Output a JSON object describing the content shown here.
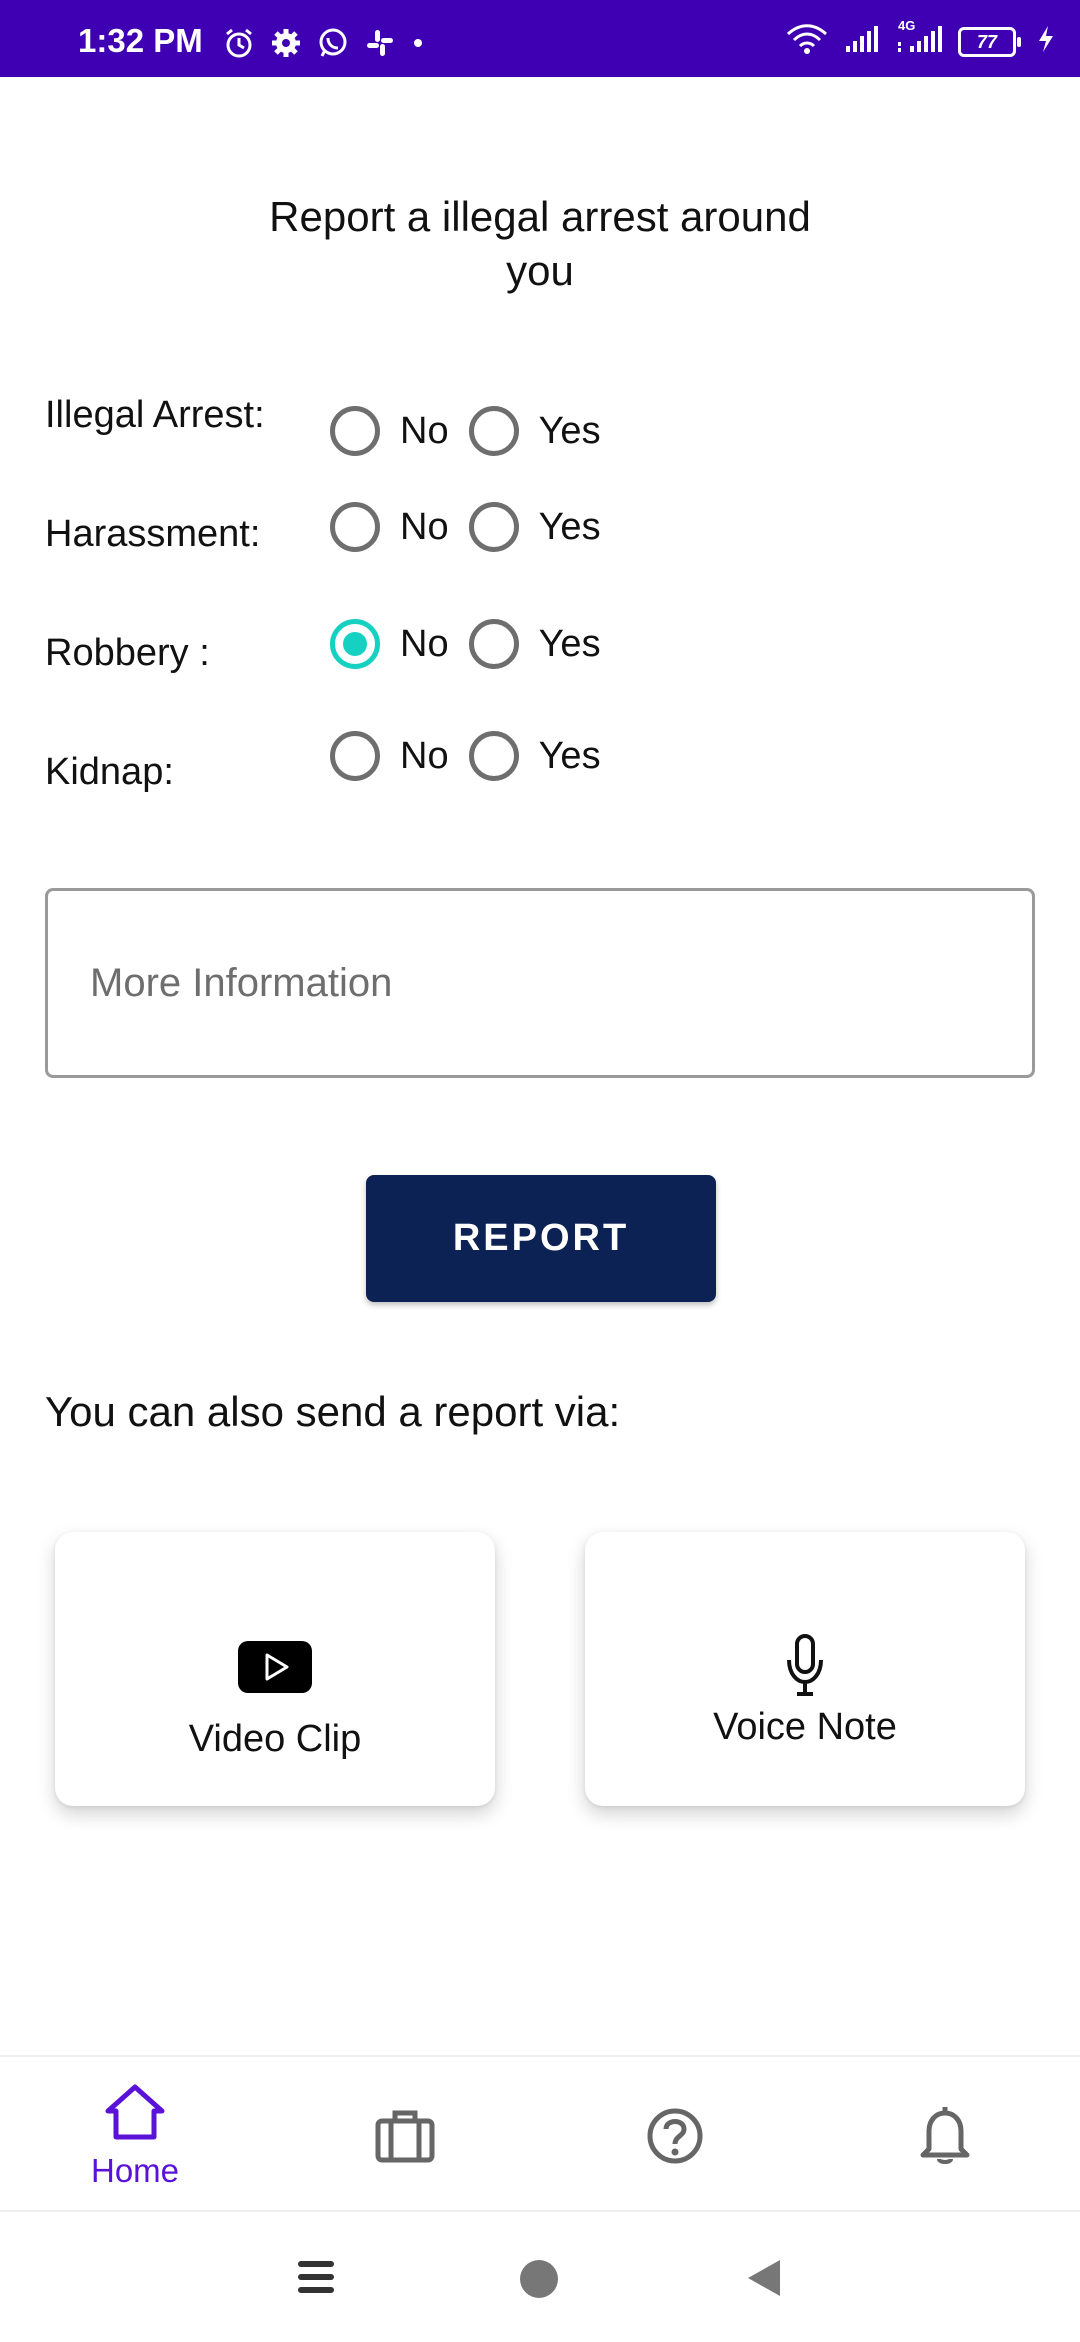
{
  "status_bar": {
    "time": "1:32 PM",
    "battery": "77",
    "network": "4G",
    "icons": [
      "alarm-icon",
      "settings-icon",
      "whatsapp-icon",
      "slack-icon",
      "dot-icon",
      "wifi-icon",
      "signal-icon",
      "signal-4g-icon",
      "battery-icon",
      "charging-icon"
    ]
  },
  "title": {
    "line1": "Report a illegal arrest around",
    "line2": "you"
  },
  "questions": [
    {
      "label": "Illegal Arrest:",
      "no": "No",
      "yes": "Yes",
      "selected": null
    },
    {
      "label": "Harassment:",
      "no": "No",
      "yes": "Yes",
      "selected": null
    },
    {
      "label": "Robbery :",
      "no": "No",
      "yes": "Yes",
      "selected": "No"
    },
    {
      "label": "Kidnap:",
      "no": "No",
      "yes": "Yes",
      "selected": null
    }
  ],
  "more_info": {
    "placeholder": "More Information",
    "value": ""
  },
  "report_button": "REPORT",
  "alternative": {
    "heading": "You can also send a report via:",
    "video": {
      "label": "Video Clip",
      "icon": "play-icon"
    },
    "voice": {
      "label": "Voice Note",
      "icon": "microphone-icon"
    }
  },
  "bottom_nav": {
    "items": [
      {
        "label": "Home",
        "icon": "home-icon",
        "active": true
      },
      {
        "label": "",
        "icon": "briefcase-icon",
        "active": false
      },
      {
        "label": "",
        "icon": "help-icon",
        "active": false
      },
      {
        "label": "",
        "icon": "bell-icon",
        "active": false
      }
    ]
  },
  "colors": {
    "status_bar": "#3f00b4",
    "accent_radio": "#14d1c1",
    "report_button": "#0c2254",
    "nav_active": "#5a12d9"
  }
}
